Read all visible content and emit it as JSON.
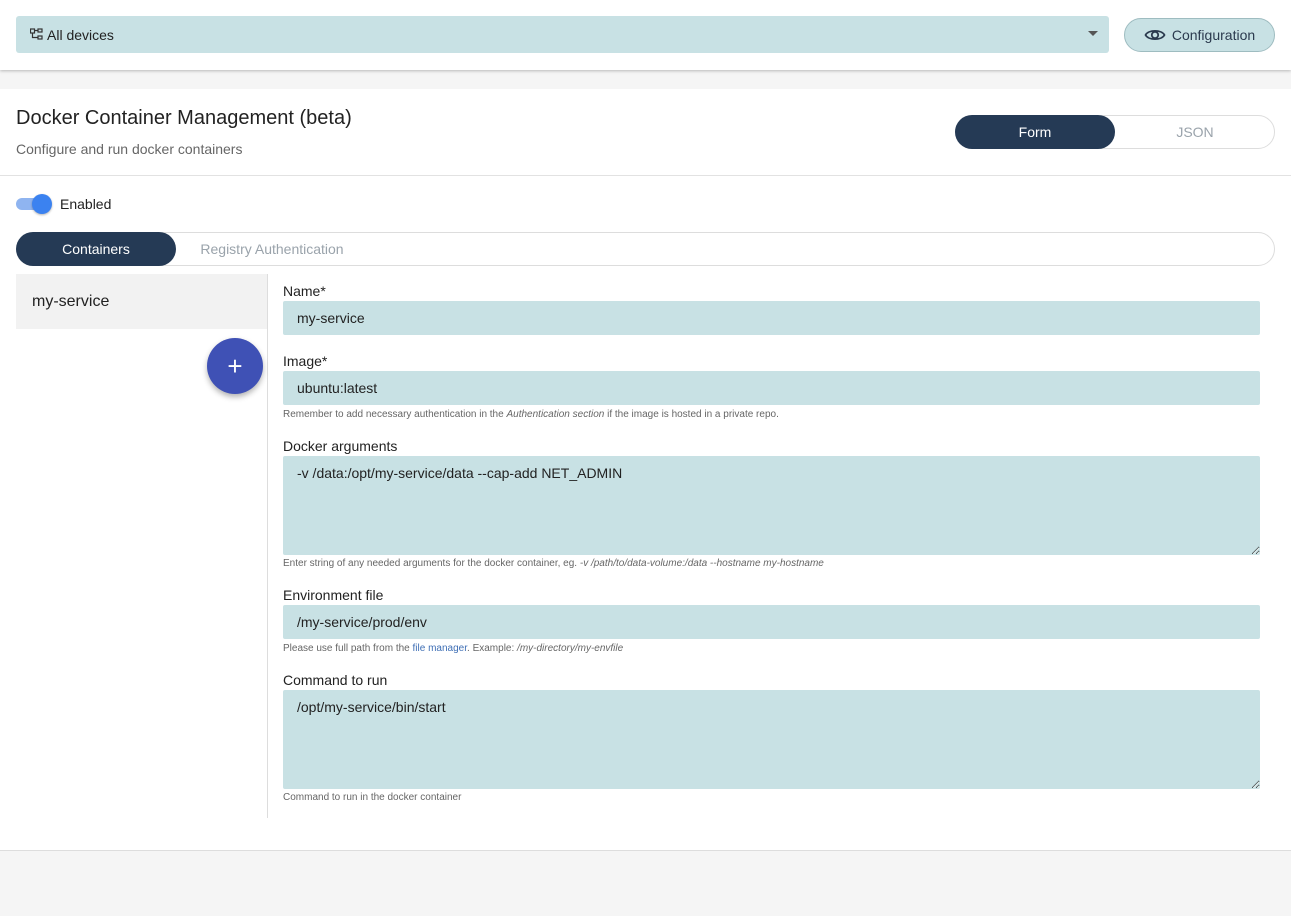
{
  "topbar": {
    "device_select": {
      "label": "All devices"
    },
    "config_button": {
      "label": "Configuration"
    }
  },
  "card": {
    "title": "Docker Container Management (beta)",
    "subtitle": "Configure and run docker containers",
    "mode_toggle": {
      "form": "Form",
      "json": "JSON",
      "active": "Form"
    }
  },
  "enabled": {
    "label": "Enabled",
    "state": true
  },
  "tabs": {
    "containers": "Containers",
    "registry_auth": "Registry Authentication",
    "active": "Containers"
  },
  "containers": {
    "items": [
      "my-service"
    ],
    "add_label": "+"
  },
  "form": {
    "name": {
      "label": "Name*",
      "value": "my-service"
    },
    "image": {
      "label": "Image*",
      "value": "ubuntu:latest",
      "hint_pre": "Remember to add necessary authentication in the ",
      "hint_em": "Authentication section",
      "hint_post": " if the image is hosted in a private repo."
    },
    "docker_args": {
      "label": "Docker arguments",
      "value": "-v /data:/opt/my-service/data --cap-add NET_ADMIN",
      "hint_pre": "Enter string of any needed arguments for the docker container, eg. ",
      "hint_em": "-v /path/to/data-volume:/data --hostname my-hostname"
    },
    "env_file": {
      "label": "Environment file",
      "value": "/my-service/prod/env",
      "hint_pre": "Please use full path from the ",
      "hint_link": "file manager",
      "hint_mid": ". Example: ",
      "hint_em": "/my-directory/my-envfile"
    },
    "command": {
      "label": "Command to run",
      "value": "/opt/my-service/bin/start",
      "hint": "Command to run in the docker container"
    }
  },
  "colors": {
    "accent": "#253a55",
    "input_bg": "#c8e1e4",
    "fab": "#3f51b5",
    "toggle": "#3b82f0"
  }
}
